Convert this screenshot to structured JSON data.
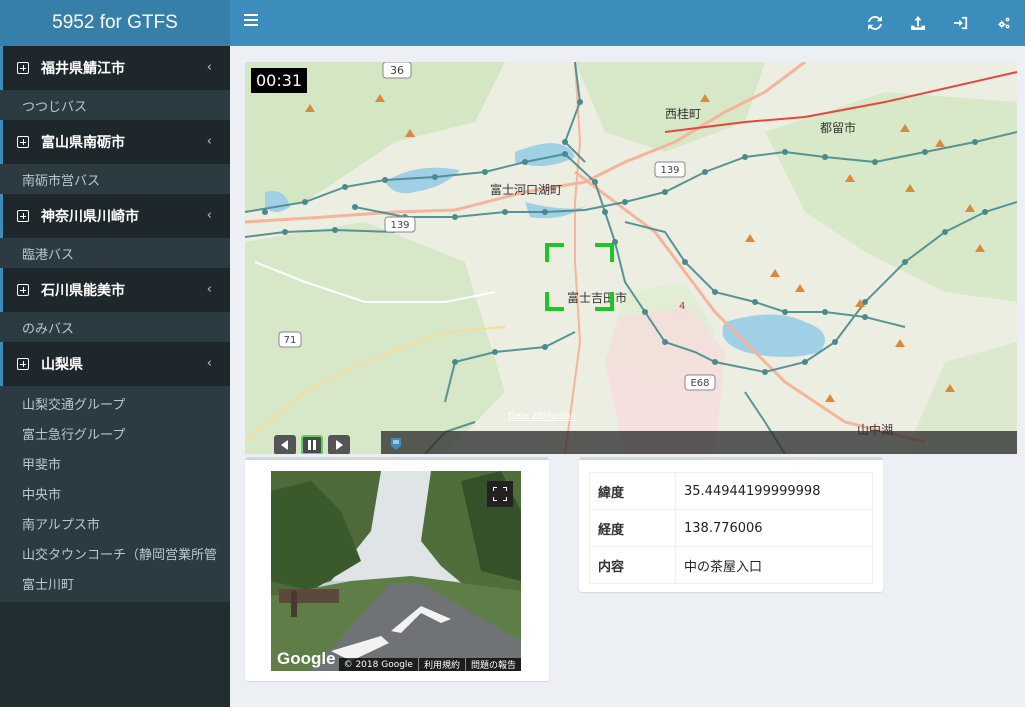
{
  "header": {
    "brand": "5952 for GTFS",
    "nav_icons": [
      "refresh-icon",
      "upload-icon",
      "sign-in-icon",
      "cogs-icon"
    ]
  },
  "sidebar": {
    "groups": [
      {
        "label": "福井県鯖江市",
        "items": [
          "つつじバス"
        ]
      },
      {
        "label": "富山県南砺市",
        "items": [
          "南砺市営バス"
        ]
      },
      {
        "label": "神奈川県川崎市",
        "items": [
          "臨港バス"
        ]
      },
      {
        "label": "石川県能美市",
        "items": [
          "のみバス"
        ]
      },
      {
        "label": "山梨県",
        "items": [
          "山梨交通グループ",
          "富士急行グループ",
          "甲斐市",
          "中央市",
          "南アルプス市",
          "山交タウンコーチ（静岡営業所管",
          "富士川町"
        ]
      }
    ]
  },
  "map": {
    "timer": "00:31",
    "attribution": "Data attribution",
    "labels": {
      "nishikatsura": "西桂町",
      "tsuru": "都留市",
      "kawaguchiko": "富士河口湖町",
      "fujiyoshida": "富士吉田市",
      "yamanakako": "山中湖",
      "r36": "36",
      "r139a": "139",
      "r139b": "139",
      "r71": "71",
      "e68": "E68",
      "r4": "4"
    }
  },
  "streetview": {
    "logo": "Google",
    "copyright": "© 2018 Google",
    "terms": "利用規約",
    "report": "問題の報告"
  },
  "info": {
    "rows": [
      {
        "key": "緯度",
        "value": "35.44944199999998"
      },
      {
        "key": "経度",
        "value": "138.776006"
      },
      {
        "key": "内容",
        "value": "中の茶屋入口"
      }
    ]
  },
  "colors": {
    "header": "#3c8dbc",
    "brand": "#367fa9",
    "sidebar": "#222d32",
    "bus_stop": "#4a8a8c",
    "highlight": "#22c22a"
  }
}
